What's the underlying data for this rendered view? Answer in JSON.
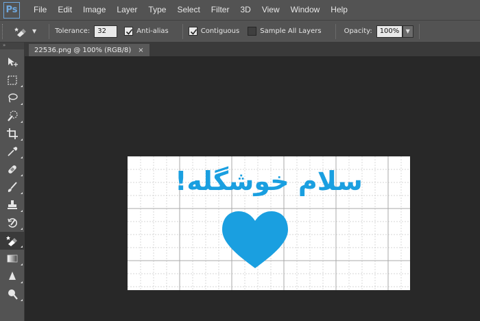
{
  "app": {
    "logo": "Ps",
    "menu": [
      "File",
      "Edit",
      "Image",
      "Layer",
      "Type",
      "Select",
      "Filter",
      "3D",
      "View",
      "Window",
      "Help"
    ]
  },
  "options": {
    "tolerance_label": "Tolerance:",
    "tolerance_value": "32",
    "antialias_label": "Anti-alias",
    "antialias_checked": true,
    "contiguous_label": "Contiguous",
    "contiguous_checked": true,
    "sample_all_label": "Sample All Layers",
    "sample_all_checked": false,
    "opacity_label": "Opacity:",
    "opacity_value": "100%"
  },
  "document": {
    "tab_title": "22536.png @ 100% (RGB/8)",
    "close_glyph": "×",
    "image_text": "سلام خوشگله!",
    "accent_color": "#1a9fe0",
    "heart": "heart-shape"
  },
  "tools": [
    "move-tool",
    "marquee-tool",
    "lasso-tool",
    "quick-selection-tool",
    "crop-tool",
    "eyedropper-tool",
    "healing-brush-tool",
    "brush-tool",
    "clone-stamp-tool",
    "history-brush-tool",
    "magic-eraser-tool",
    "gradient-tool",
    "blur-tool",
    "dodge-tool"
  ],
  "active_tool": "magic-eraser-tool"
}
